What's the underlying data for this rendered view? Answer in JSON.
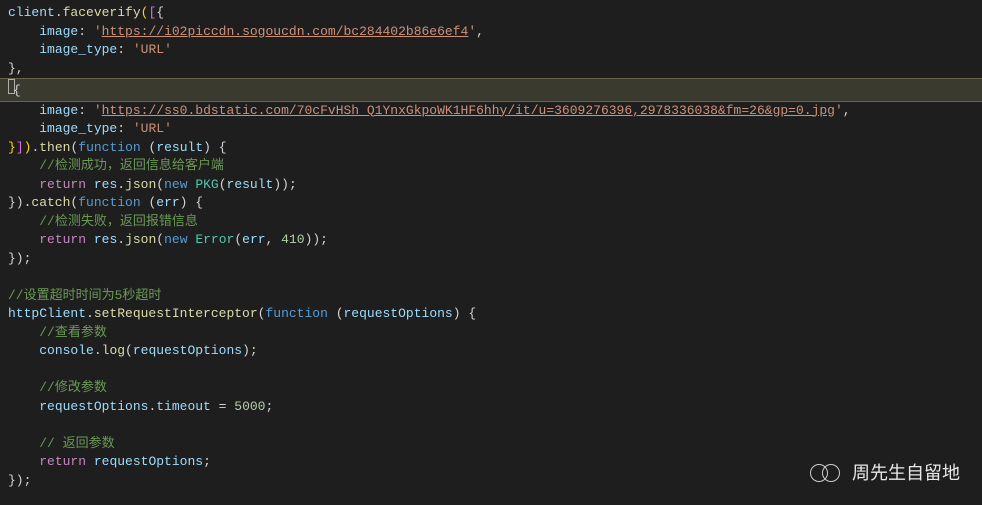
{
  "code": {
    "l1_obj": "client",
    "l1_method": "faceverify",
    "l2_key": "image",
    "l2_url": "https://i02piccdn.sogoucdn.com/bc284402b86e6ef4",
    "l3_key": "image_type",
    "l3_val": "URL",
    "l6_key": "image",
    "l6_url": "https://ss0.bdstatic.com/70cFvHSh_Q1YnxGkpoWK1HF6hhy/it/u=3609276396,2978336038&fm=26&gp=0.jpg",
    "l7_key": "image_type",
    "l7_val": "URL",
    "l8_then": "then",
    "l8_fn": "function",
    "l8_param": "result",
    "l9_cmt": "//检测成功，返回信息给客户端",
    "l10_ret": "return",
    "l10_res": "res",
    "l10_json": "json",
    "l10_new": "new",
    "l10_pkg": "PKG",
    "l10_arg": "result",
    "l11_catch": "catch",
    "l11_fn": "function",
    "l11_param": "err",
    "l12_cmt": "//检测失败，返回报错信息",
    "l13_ret": "return",
    "l13_res": "res",
    "l13_json": "json",
    "l13_new": "new",
    "l13_err": "Error",
    "l13_arg1": "err",
    "l13_arg2": "410",
    "l16_cmt": "//设置超时时间为5秒超时",
    "l17_obj": "httpClient",
    "l17_method": "setRequestInterceptor",
    "l17_fn": "function",
    "l17_param": "requestOptions",
    "l18_cmt": "//查看参数",
    "l19_console": "console",
    "l19_log": "log",
    "l19_arg": "requestOptions",
    "l21_cmt": "//修改参数",
    "l22_obj": "requestOptions",
    "l22_prop": "timeout",
    "l22_val": "5000",
    "l24_cmt": "// 返回参数",
    "l25_ret": "return",
    "l25_val": "requestOptions"
  },
  "watermark": "周先生自留地"
}
